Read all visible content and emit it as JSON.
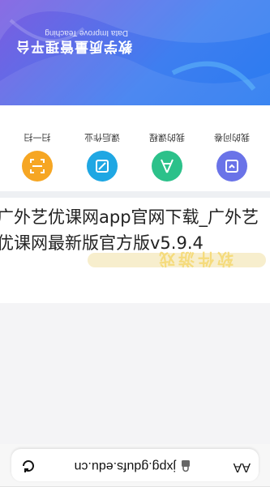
{
  "app": {
    "brand_title": "教学质量管理平台",
    "brand_subtitle": "Data Improve Teaching",
    "menu": [
      {
        "label": "扫一扫",
        "icon": "scan-icon",
        "color": "#f6a623"
      },
      {
        "label": "课后作业",
        "icon": "homework-icon",
        "color": "#1fa7e3"
      },
      {
        "label": "我的课程",
        "icon": "course-icon",
        "color": "#2cc18a"
      },
      {
        "label": "我的问卷",
        "icon": "questionnaire-icon",
        "color": "#6a73e8"
      }
    ],
    "banner_colors": [
      "#2a7bf0",
      "#7d5ce0"
    ]
  },
  "article": {
    "title": "广外艺优课网app官网下载_广外艺优课网最新版官方版v5.9.4",
    "watermark_text": "软件游戏"
  },
  "browser": {
    "aa_label": "AA",
    "url": "jxpg.gdufs.edu.cn",
    "reload_icon": "reload-icon",
    "lock_icon": "lock-icon"
  }
}
